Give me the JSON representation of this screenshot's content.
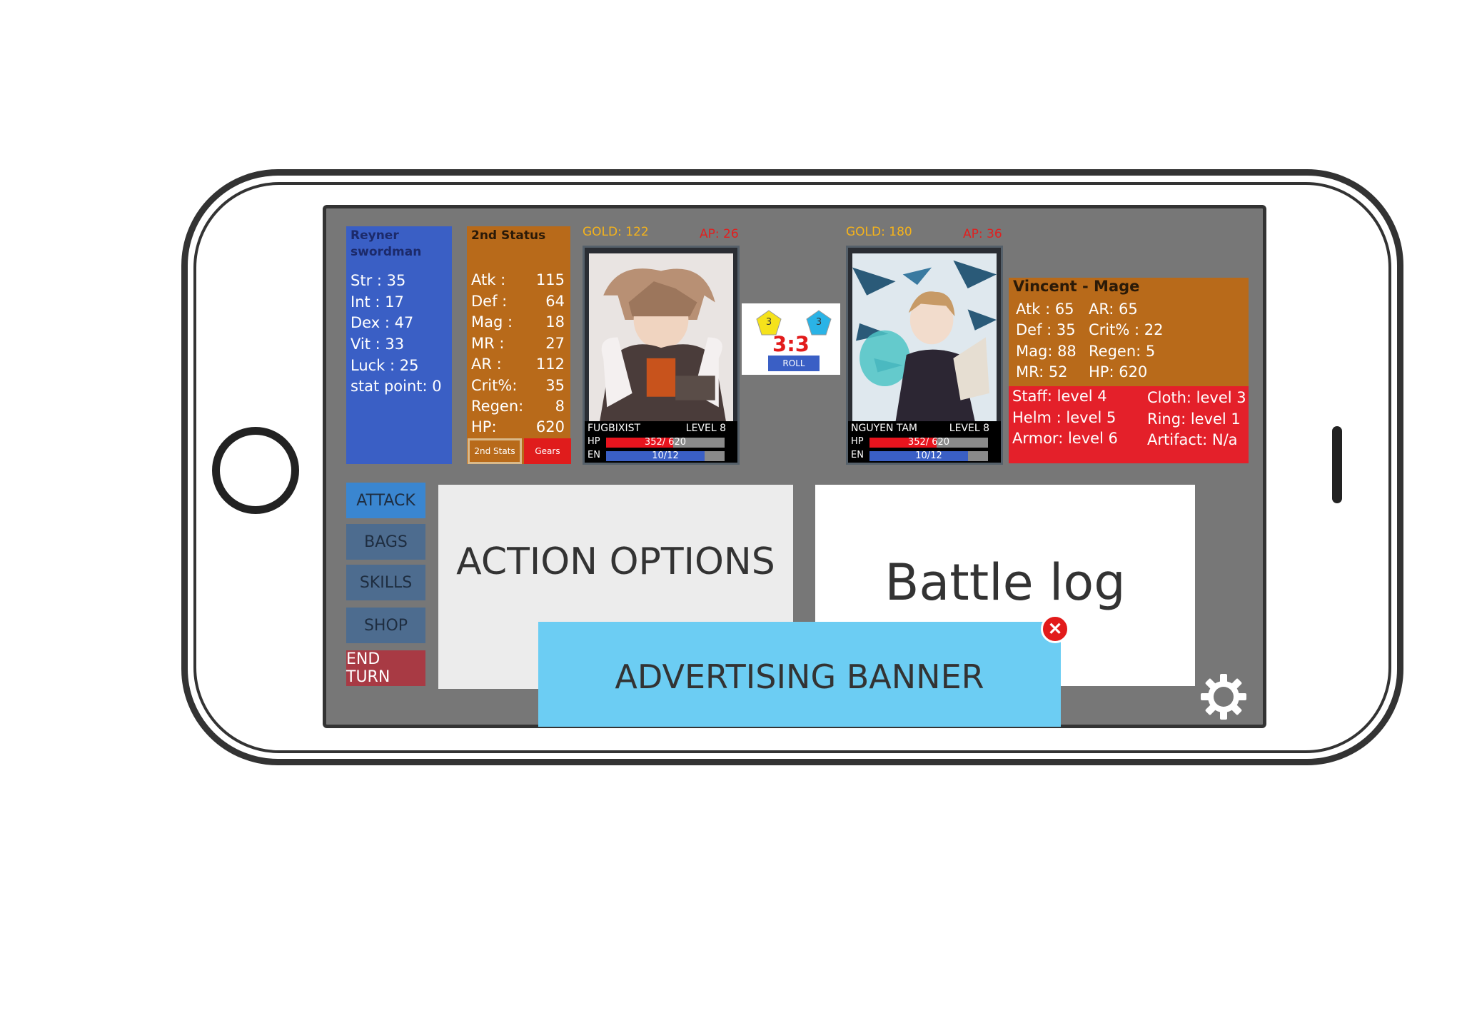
{
  "player": {
    "name_line1": "Reyner",
    "name_line2": "swordman",
    "stats": [
      "Str   : 35",
      "Int : 17",
      "Dex  : 47",
      "Vit   : 33",
      "Luck : 25",
      "stat point: 0"
    ]
  },
  "second_status": {
    "title": "2nd Status",
    "rows": [
      {
        "label": "Atk    :",
        "value": "115"
      },
      {
        "label": "Def    :",
        "value": "64"
      },
      {
        "label": "Mag    :",
        "value": "18"
      },
      {
        "label": "MR      :",
        "value": "27"
      },
      {
        "label": "AR    :",
        "value": "112"
      },
      {
        "label": "Crit%:",
        "value": "35"
      },
      {
        "label": "Regen:",
        "value": "8"
      },
      {
        "label": "HP:",
        "value": "620"
      }
    ],
    "tab_stats": "2nd Stats",
    "tab_gears": "Gears"
  },
  "player_card": {
    "gold": "GOLD: 122",
    "ap": "AP: 26",
    "name": "FUGBIXIST",
    "level": "LEVEL 8",
    "hp_label": "HP",
    "hp_text": "352/ 620",
    "hp_fraction": 0.568,
    "en_label": "EN",
    "en_text": "10/12",
    "en_fraction": 0.833
  },
  "dice": {
    "left_face": "3",
    "right_face": "3",
    "score": "3:3",
    "roll_label": "ROLL",
    "left_color": "#f5e21b",
    "right_color": "#2ab3e6"
  },
  "enemy_card": {
    "gold": "GOLD: 180",
    "ap": "AP: 36",
    "name": "NGUYEN TAM",
    "level": "LEVEL 8",
    "hp_label": "HP",
    "hp_text": "352/ 620",
    "hp_fraction": 0.568,
    "en_label": "EN",
    "en_text": "10/12",
    "en_fraction": 0.833
  },
  "enemy": {
    "title": "Vincent - Mage",
    "stats_left": [
      "Atk : 65",
      "Def : 35",
      "Mag: 88",
      "MR: 52"
    ],
    "stats_right": [
      "AR: 65",
      "Crit% : 22",
      "Regen: 5",
      "HP: 620"
    ],
    "gear_left": [
      "Staff: level 4",
      "Helm : level 5",
      "Armor: level 6"
    ],
    "gear_right": [
      "Cloth: level 3",
      "Ring: level 1",
      "Artifact: N/a"
    ]
  },
  "actions": {
    "attack": "ATTACK",
    "bags": "BAGS",
    "skills": "SKILLS",
    "shop": "SHOP",
    "end_turn": "END TURN"
  },
  "action_options": "ACTION OPTIONS",
  "battle_log": "Battle log",
  "ad_banner": "ADVERTISING BANNER",
  "icons": {
    "close": "close-icon",
    "settings": "gear-icon",
    "dice": "dice-icon"
  },
  "colors": {
    "hp_bar": "#e8141e",
    "en_bar": "#3a5fc5",
    "attack_button": "#3a86d0",
    "end_turn_button": "#a83a44"
  }
}
